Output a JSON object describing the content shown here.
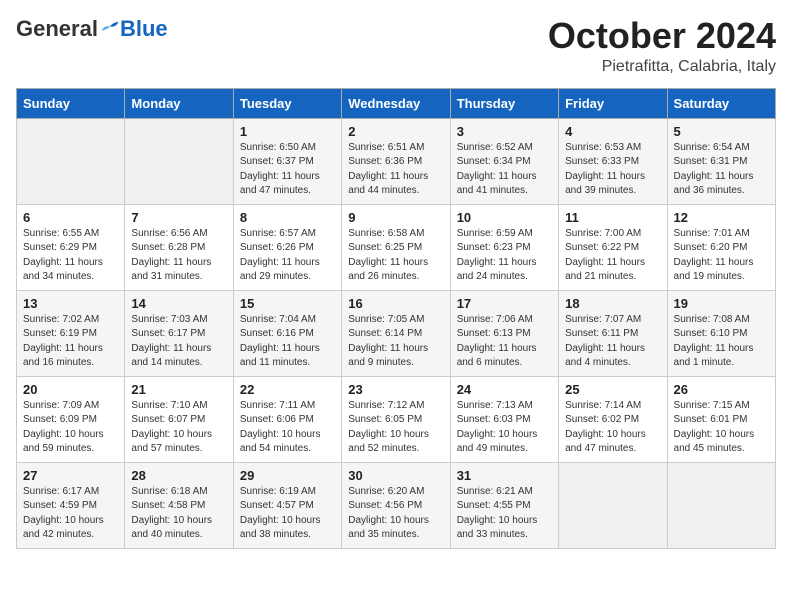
{
  "header": {
    "logo_general": "General",
    "logo_blue": "Blue",
    "month_title": "October 2024",
    "subtitle": "Pietrafitta, Calabria, Italy"
  },
  "weekdays": [
    "Sunday",
    "Monday",
    "Tuesday",
    "Wednesday",
    "Thursday",
    "Friday",
    "Saturday"
  ],
  "weeks": [
    [
      {
        "day": "",
        "sunrise": "",
        "sunset": "",
        "daylight": ""
      },
      {
        "day": "",
        "sunrise": "",
        "sunset": "",
        "daylight": ""
      },
      {
        "day": "1",
        "sunrise": "Sunrise: 6:50 AM",
        "sunset": "Sunset: 6:37 PM",
        "daylight": "Daylight: 11 hours and 47 minutes."
      },
      {
        "day": "2",
        "sunrise": "Sunrise: 6:51 AM",
        "sunset": "Sunset: 6:36 PM",
        "daylight": "Daylight: 11 hours and 44 minutes."
      },
      {
        "day": "3",
        "sunrise": "Sunrise: 6:52 AM",
        "sunset": "Sunset: 6:34 PM",
        "daylight": "Daylight: 11 hours and 41 minutes."
      },
      {
        "day": "4",
        "sunrise": "Sunrise: 6:53 AM",
        "sunset": "Sunset: 6:33 PM",
        "daylight": "Daylight: 11 hours and 39 minutes."
      },
      {
        "day": "5",
        "sunrise": "Sunrise: 6:54 AM",
        "sunset": "Sunset: 6:31 PM",
        "daylight": "Daylight: 11 hours and 36 minutes."
      }
    ],
    [
      {
        "day": "6",
        "sunrise": "Sunrise: 6:55 AM",
        "sunset": "Sunset: 6:29 PM",
        "daylight": "Daylight: 11 hours and 34 minutes."
      },
      {
        "day": "7",
        "sunrise": "Sunrise: 6:56 AM",
        "sunset": "Sunset: 6:28 PM",
        "daylight": "Daylight: 11 hours and 31 minutes."
      },
      {
        "day": "8",
        "sunrise": "Sunrise: 6:57 AM",
        "sunset": "Sunset: 6:26 PM",
        "daylight": "Daylight: 11 hours and 29 minutes."
      },
      {
        "day": "9",
        "sunrise": "Sunrise: 6:58 AM",
        "sunset": "Sunset: 6:25 PM",
        "daylight": "Daylight: 11 hours and 26 minutes."
      },
      {
        "day": "10",
        "sunrise": "Sunrise: 6:59 AM",
        "sunset": "Sunset: 6:23 PM",
        "daylight": "Daylight: 11 hours and 24 minutes."
      },
      {
        "day": "11",
        "sunrise": "Sunrise: 7:00 AM",
        "sunset": "Sunset: 6:22 PM",
        "daylight": "Daylight: 11 hours and 21 minutes."
      },
      {
        "day": "12",
        "sunrise": "Sunrise: 7:01 AM",
        "sunset": "Sunset: 6:20 PM",
        "daylight": "Daylight: 11 hours and 19 minutes."
      }
    ],
    [
      {
        "day": "13",
        "sunrise": "Sunrise: 7:02 AM",
        "sunset": "Sunset: 6:19 PM",
        "daylight": "Daylight: 11 hours and 16 minutes."
      },
      {
        "day": "14",
        "sunrise": "Sunrise: 7:03 AM",
        "sunset": "Sunset: 6:17 PM",
        "daylight": "Daylight: 11 hours and 14 minutes."
      },
      {
        "day": "15",
        "sunrise": "Sunrise: 7:04 AM",
        "sunset": "Sunset: 6:16 PM",
        "daylight": "Daylight: 11 hours and 11 minutes."
      },
      {
        "day": "16",
        "sunrise": "Sunrise: 7:05 AM",
        "sunset": "Sunset: 6:14 PM",
        "daylight": "Daylight: 11 hours and 9 minutes."
      },
      {
        "day": "17",
        "sunrise": "Sunrise: 7:06 AM",
        "sunset": "Sunset: 6:13 PM",
        "daylight": "Daylight: 11 hours and 6 minutes."
      },
      {
        "day": "18",
        "sunrise": "Sunrise: 7:07 AM",
        "sunset": "Sunset: 6:11 PM",
        "daylight": "Daylight: 11 hours and 4 minutes."
      },
      {
        "day": "19",
        "sunrise": "Sunrise: 7:08 AM",
        "sunset": "Sunset: 6:10 PM",
        "daylight": "Daylight: 11 hours and 1 minute."
      }
    ],
    [
      {
        "day": "20",
        "sunrise": "Sunrise: 7:09 AM",
        "sunset": "Sunset: 6:09 PM",
        "daylight": "Daylight: 10 hours and 59 minutes."
      },
      {
        "day": "21",
        "sunrise": "Sunrise: 7:10 AM",
        "sunset": "Sunset: 6:07 PM",
        "daylight": "Daylight: 10 hours and 57 minutes."
      },
      {
        "day": "22",
        "sunrise": "Sunrise: 7:11 AM",
        "sunset": "Sunset: 6:06 PM",
        "daylight": "Daylight: 10 hours and 54 minutes."
      },
      {
        "day": "23",
        "sunrise": "Sunrise: 7:12 AM",
        "sunset": "Sunset: 6:05 PM",
        "daylight": "Daylight: 10 hours and 52 minutes."
      },
      {
        "day": "24",
        "sunrise": "Sunrise: 7:13 AM",
        "sunset": "Sunset: 6:03 PM",
        "daylight": "Daylight: 10 hours and 49 minutes."
      },
      {
        "day": "25",
        "sunrise": "Sunrise: 7:14 AM",
        "sunset": "Sunset: 6:02 PM",
        "daylight": "Daylight: 10 hours and 47 minutes."
      },
      {
        "day": "26",
        "sunrise": "Sunrise: 7:15 AM",
        "sunset": "Sunset: 6:01 PM",
        "daylight": "Daylight: 10 hours and 45 minutes."
      }
    ],
    [
      {
        "day": "27",
        "sunrise": "Sunrise: 6:17 AM",
        "sunset": "Sunset: 4:59 PM",
        "daylight": "Daylight: 10 hours and 42 minutes."
      },
      {
        "day": "28",
        "sunrise": "Sunrise: 6:18 AM",
        "sunset": "Sunset: 4:58 PM",
        "daylight": "Daylight: 10 hours and 40 minutes."
      },
      {
        "day": "29",
        "sunrise": "Sunrise: 6:19 AM",
        "sunset": "Sunset: 4:57 PM",
        "daylight": "Daylight: 10 hours and 38 minutes."
      },
      {
        "day": "30",
        "sunrise": "Sunrise: 6:20 AM",
        "sunset": "Sunset: 4:56 PM",
        "daylight": "Daylight: 10 hours and 35 minutes."
      },
      {
        "day": "31",
        "sunrise": "Sunrise: 6:21 AM",
        "sunset": "Sunset: 4:55 PM",
        "daylight": "Daylight: 10 hours and 33 minutes."
      },
      {
        "day": "",
        "sunrise": "",
        "sunset": "",
        "daylight": ""
      },
      {
        "day": "",
        "sunrise": "",
        "sunset": "",
        "daylight": ""
      }
    ]
  ]
}
